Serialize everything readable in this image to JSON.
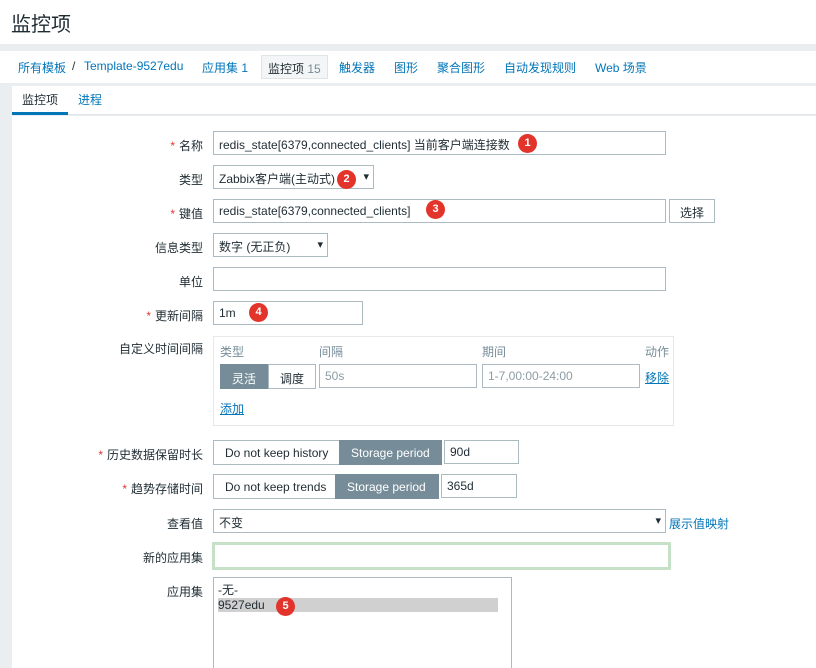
{
  "page_title": "监控项",
  "breadcrumb": {
    "all_templates": "所有模板",
    "separator": "/",
    "template": "Template-9527edu",
    "applications": "应用集 1",
    "items_label": "监控项",
    "items_count": "15",
    "triggers": "触发器",
    "graphs": "图形",
    "screens": "聚合图形",
    "discovery": "自动发现规则",
    "web": "Web 场景"
  },
  "tabs": [
    {
      "label": "监控项",
      "active": true
    },
    {
      "label": "进程",
      "active": false
    }
  ],
  "form": {
    "name": {
      "label": "名称",
      "value": "redis_state[6379,connected_clients] 当前客户端连接数",
      "required": true
    },
    "type": {
      "label": "类型",
      "value": "Zabbix客户端(主动式)"
    },
    "key": {
      "label": "键值",
      "value": "redis_state[6379,connected_clients]",
      "required": true,
      "select_button": "选择"
    },
    "value_type": {
      "label": "信息类型",
      "value": "数字 (无正负)"
    },
    "units": {
      "label": "单位",
      "value": ""
    },
    "delay": {
      "label": "更新间隔",
      "value": "1m",
      "required": true
    },
    "custom_intervals": {
      "label": "自定义时间间隔",
      "headers": {
        "type": "类型",
        "interval": "间隔",
        "period": "期间",
        "action": "动作"
      },
      "type_options": [
        "灵活",
        "调度"
      ],
      "interval_placeholder": "50s",
      "period_placeholder": "1-7,00:00-24:00",
      "remove": "移除",
      "add": "添加"
    },
    "history": {
      "label": "历史数据保留时长",
      "required": true,
      "options": [
        "Do not keep history",
        "Storage period"
      ],
      "value": "90d"
    },
    "trends": {
      "label": "趋势存储时间",
      "required": true,
      "options": [
        "Do not keep trends",
        "Storage period"
      ],
      "value": "365d"
    },
    "valuemap": {
      "label": "查看值",
      "value": "不变",
      "link": "展示值映射"
    },
    "new_application": {
      "label": "新的应用集",
      "value": ""
    },
    "applications": {
      "label": "应用集",
      "options": [
        "-无-",
        "9527edu"
      ],
      "selected": "9527edu"
    }
  },
  "badges": [
    "1",
    "2",
    "3",
    "4",
    "5"
  ],
  "colors": {
    "link": "#0275b8",
    "badge": "#e2342a",
    "toggle_on": "#768d99",
    "required": "#e33734",
    "focus_border": "#c5e2c8"
  }
}
